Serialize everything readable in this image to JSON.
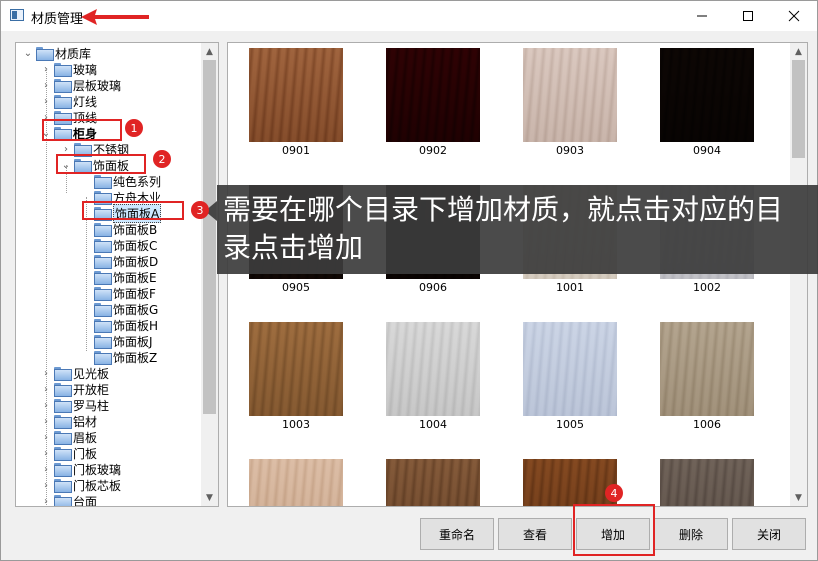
{
  "window": {
    "title": "材质管理",
    "controls": [
      "minimize-icon",
      "maximize-icon",
      "close-icon"
    ]
  },
  "tree": {
    "root": "材质库",
    "items": [
      {
        "label": "玻璃",
        "level": 1,
        "expander": "collapsed"
      },
      {
        "label": "层板玻璃",
        "level": 1,
        "expander": "collapsed"
      },
      {
        "label": "灯线",
        "level": 1,
        "expander": "collapsed"
      },
      {
        "label": "顶线",
        "level": 1,
        "expander": "collapsed"
      },
      {
        "label": "柜身",
        "level": 1,
        "expander": "expanded",
        "bold": true
      },
      {
        "label": "不锈钢",
        "level": 2,
        "expander": "collapsed"
      },
      {
        "label": "饰面板",
        "level": 2,
        "expander": "expanded"
      },
      {
        "label": "纯色系列",
        "level": 3,
        "expander": "none"
      },
      {
        "label": "方舟木业",
        "level": 3,
        "expander": "none"
      },
      {
        "label": "饰面板A",
        "level": 3,
        "expander": "none",
        "selected": true
      },
      {
        "label": "饰面板B",
        "level": 3,
        "expander": "none"
      },
      {
        "label": "饰面板C",
        "level": 3,
        "expander": "none"
      },
      {
        "label": "饰面板D",
        "level": 3,
        "expander": "none"
      },
      {
        "label": "饰面板E",
        "level": 3,
        "expander": "none"
      },
      {
        "label": "饰面板F",
        "level": 3,
        "expander": "none"
      },
      {
        "label": "饰面板G",
        "level": 3,
        "expander": "none"
      },
      {
        "label": "饰面板H",
        "level": 3,
        "expander": "none"
      },
      {
        "label": "饰面板J",
        "level": 3,
        "expander": "none"
      },
      {
        "label": "饰面板Z",
        "level": 3,
        "expander": "none"
      },
      {
        "label": "见光板",
        "level": 1,
        "expander": "collapsed"
      },
      {
        "label": "开放柜",
        "level": 1,
        "expander": "collapsed"
      },
      {
        "label": "罗马柱",
        "level": 1,
        "expander": "collapsed"
      },
      {
        "label": "铝材",
        "level": 1,
        "expander": "collapsed"
      },
      {
        "label": "眉板",
        "level": 1,
        "expander": "collapsed"
      },
      {
        "label": "门板",
        "level": 1,
        "expander": "collapsed"
      },
      {
        "label": "门板玻璃",
        "level": 1,
        "expander": "collapsed"
      },
      {
        "label": "门板芯板",
        "level": 1,
        "expander": "collapsed"
      },
      {
        "label": "台面",
        "level": 1,
        "expander": "collapsed"
      }
    ]
  },
  "materials": [
    {
      "name": "0901",
      "c1": "#caa07e",
      "c2": "#a87b58"
    },
    {
      "name": "0902",
      "c1": "#6e1820",
      "c2": "#4a0c12"
    },
    {
      "name": "0903",
      "c1": "#ece2dd",
      "c2": "#d9ccc5"
    },
    {
      "name": "0904",
      "c1": "#3a2a22",
      "c2": "#241813"
    },
    {
      "name": "0905",
      "c1": "#503628",
      "c2": "#33231a"
    },
    {
      "name": "0906",
      "c1": "#3c2518",
      "c2": "#2a1810"
    },
    {
      "name": "1001",
      "c1": "#f0ece6",
      "c2": "#e2dcd4"
    },
    {
      "name": "1002",
      "c1": "#e6e6e8",
      "c2": "#d6d6da"
    },
    {
      "name": "1003",
      "c1": "#c9a77f",
      "c2": "#a98963"
    },
    {
      "name": "1004",
      "c1": "#ebebeb",
      "c2": "#d8d8d8"
    },
    {
      "name": "1005",
      "c1": "#e4e9f2",
      "c2": "#d2d8e4"
    },
    {
      "name": "1006",
      "c1": "#d6cdbf",
      "c2": "#c0b5a4"
    },
    {
      "name": "",
      "c1": "#eddcce",
      "c2": "#dcc6b3"
    },
    {
      "name": "",
      "c1": "#b8987a",
      "c2": "#957659"
    },
    {
      "name": "",
      "c1": "#b8895c",
      "c2": "#946a42"
    },
    {
      "name": "",
      "c1": "#a99f97",
      "c2": "#8b8079"
    }
  ],
  "callout_text": "需要在哪个目录下增加材质，就点击对应的目录点击增加",
  "buttons": {
    "rename": "重命名",
    "view": "查看",
    "add": "增加",
    "delete": "删除",
    "close": "关闭"
  },
  "badges": [
    "1",
    "2",
    "3",
    "4"
  ],
  "colors": {
    "annotation_red": "#e02424",
    "selection": "#cce8ff",
    "callout_bg": "#3c3c3c"
  }
}
